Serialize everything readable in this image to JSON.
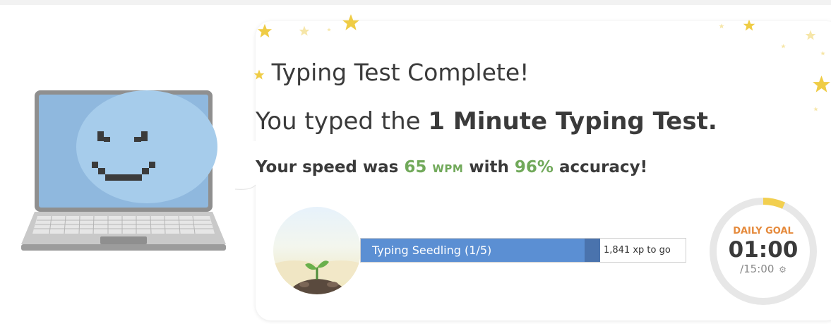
{
  "result": {
    "title": "Typing Test Complete!",
    "subtitle_prefix": "You typed the ",
    "test_name": "1 Minute Typing Test.",
    "speed_prefix": "Your speed was ",
    "wpm_value": "65",
    "wpm_unit": "WPM",
    "speed_middle": " with ",
    "accuracy": "96%",
    "speed_suffix": " accuracy!"
  },
  "level": {
    "name": "Typing Seedling (1/5)",
    "xp_to_go": "1,841 xp to go"
  },
  "daily_goal": {
    "label": "DAILY GOAL",
    "time": "01:00",
    "total": "/15:00",
    "progress_fraction": 0.067
  },
  "colors": {
    "accent_green": "#71a95a",
    "bar_blue": "#5b8fd3",
    "goal_orange": "#e58a3c",
    "star_gold": "#f2cf4f"
  },
  "icons": {
    "settings": "gear-icon",
    "mascot": "laptop-smiley-icon",
    "plant": "seedling-icon"
  }
}
